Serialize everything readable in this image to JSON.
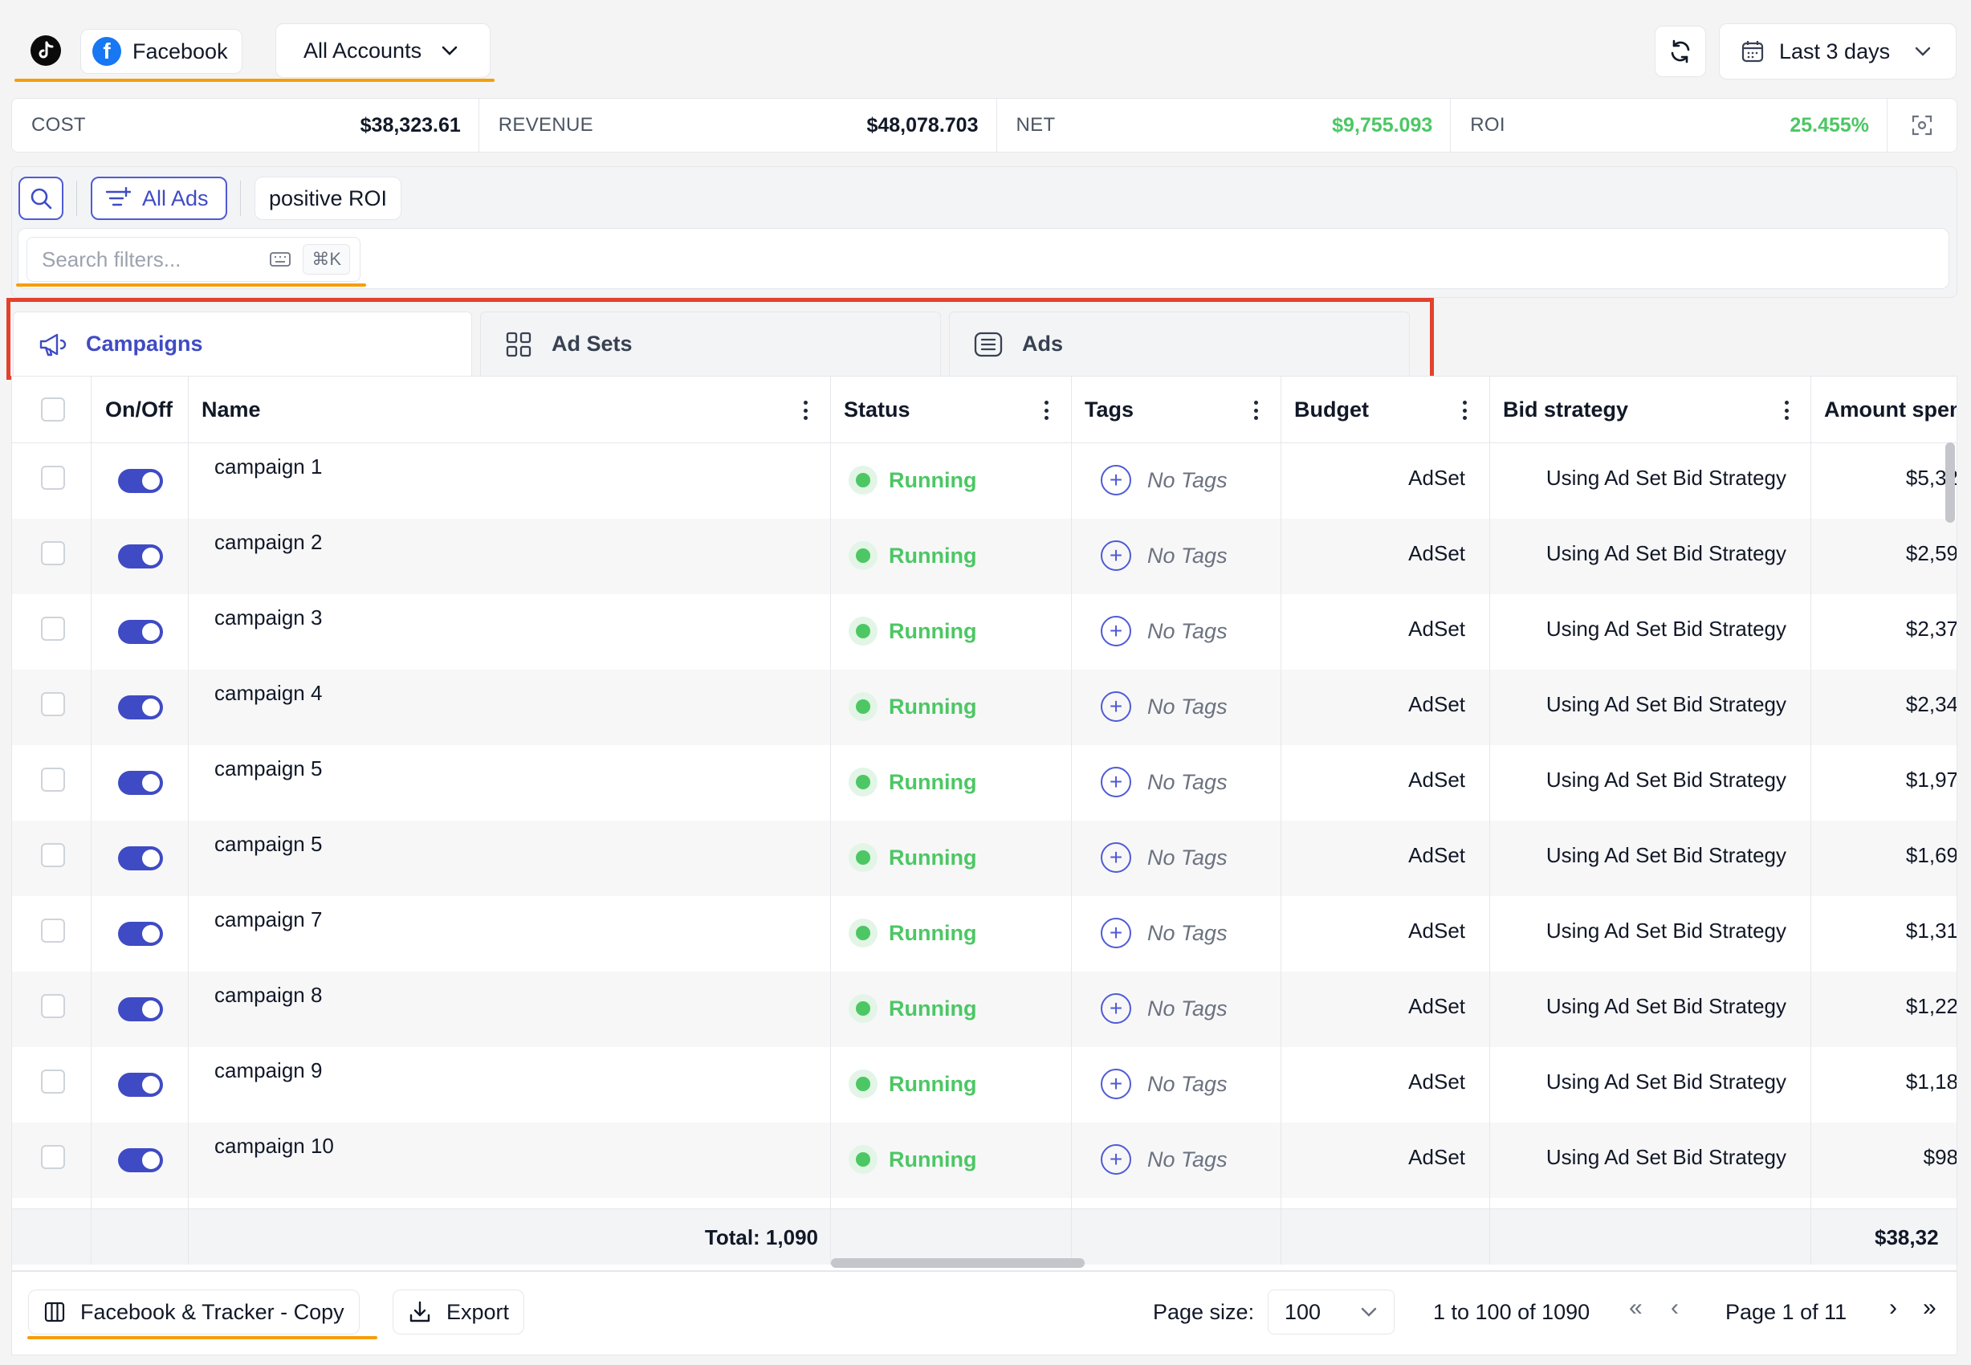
{
  "platforms": {
    "tiktok_icon": "tiktok-icon",
    "facebook_label": "Facebook"
  },
  "accounts": {
    "selected": "All Accounts"
  },
  "date_range": {
    "label": "Last 3 days"
  },
  "metrics": {
    "cost_label": "COST",
    "cost_value": "$38,323.61",
    "revenue_label": "REVENUE",
    "revenue_value": "$48,078.703",
    "net_label": "NET",
    "net_value": "$9,755.093",
    "roi_label": "ROI",
    "roi_value": "25.455%"
  },
  "filters": {
    "all_ads_label": "All Ads",
    "chip_label": "positive ROI",
    "search_placeholder": "Search filters...",
    "shortcut": "⌘K"
  },
  "tabs": [
    {
      "label": "Campaigns",
      "active": true
    },
    {
      "label": "Ad Sets",
      "active": false
    },
    {
      "label": "Ads",
      "active": false
    }
  ],
  "table": {
    "headers": {
      "onoff": "On/Off",
      "name": "Name",
      "status": "Status",
      "tags": "Tags",
      "budget": "Budget",
      "bid": "Bid strategy",
      "amount": "Amount spen"
    },
    "rows": [
      {
        "name": "campaign 1",
        "status": "Running",
        "tags": "No Tags",
        "budget": "AdSet",
        "bid": "Using Ad Set Bid Strategy",
        "amount": "$5,32"
      },
      {
        "name": "campaign 2",
        "status": "Running",
        "tags": "No Tags",
        "budget": "AdSet",
        "bid": "Using Ad Set Bid Strategy",
        "amount": "$2,59"
      },
      {
        "name": "campaign 3",
        "status": "Running",
        "tags": "No Tags",
        "budget": "AdSet",
        "bid": "Using Ad Set Bid Strategy",
        "amount": "$2,37"
      },
      {
        "name": "campaign 4",
        "status": "Running",
        "tags": "No Tags",
        "budget": "AdSet",
        "bid": "Using Ad Set Bid Strategy",
        "amount": "$2,34"
      },
      {
        "name": "campaign 5",
        "status": "Running",
        "tags": "No Tags",
        "budget": "AdSet",
        "bid": "Using Ad Set Bid Strategy",
        "amount": "$1,97"
      },
      {
        "name": "campaign 5",
        "status": "Running",
        "tags": "No Tags",
        "budget": "AdSet",
        "bid": "Using Ad Set Bid Strategy",
        "amount": "$1,69"
      },
      {
        "name": "campaign 7",
        "status": "Running",
        "tags": "No Tags",
        "budget": "AdSet",
        "bid": "Using Ad Set Bid Strategy",
        "amount": "$1,31"
      },
      {
        "name": "campaign 8",
        "status": "Running",
        "tags": "No Tags",
        "budget": "AdSet",
        "bid": "Using Ad Set Bid Strategy",
        "amount": "$1,22"
      },
      {
        "name": "campaign 9",
        "status": "Running",
        "tags": "No Tags",
        "budget": "AdSet",
        "bid": "Using Ad Set Bid Strategy",
        "amount": "$1,18"
      },
      {
        "name": "campaign 10",
        "status": "Running",
        "tags": "No Tags",
        "budget": "AdSet",
        "bid": "Using Ad Set Bid Strategy",
        "amount": "$98"
      }
    ],
    "total_label": "Total: 1,090",
    "total_amount": "$38,32"
  },
  "footer": {
    "view_label": "Facebook & Tracker - Copy",
    "export_label": "Export",
    "page_size_label": "Page size:",
    "page_size_value": "100",
    "range_text": "1 to 100 of 1090",
    "page_text": "Page 1 of 11"
  },
  "colors": {
    "accent": "#3f4bc4",
    "running": "#4cc764",
    "highlight_frame": "#e3412c",
    "underline": "#f59e0b"
  }
}
